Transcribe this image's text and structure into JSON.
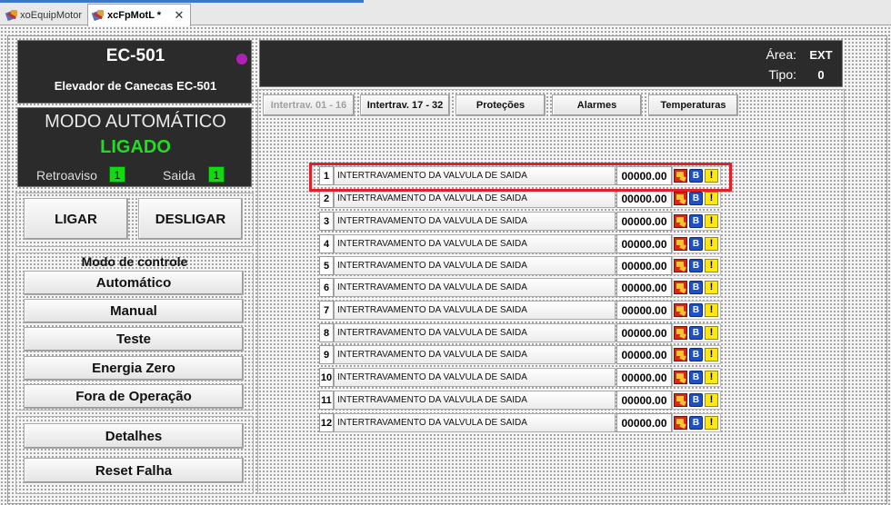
{
  "tabs": [
    {
      "label": "xoEquipMotor",
      "active": false
    },
    {
      "label": "xcFpMotL *",
      "active": true
    }
  ],
  "tab_close_glyph": "✕",
  "equipment": {
    "tag": "EC-501",
    "description": "Elevador de Canecas EC-501",
    "status_dot_color": "#b21fb8"
  },
  "mode_panel": {
    "title": "MODO AUTOMÁTICO",
    "state": "LIGADO",
    "retroaviso_label": "Retroaviso",
    "retroaviso_value": "1",
    "saida_label": "Saida",
    "saida_value": "1"
  },
  "commands": {
    "ligar": "LIGAR",
    "desligar": "DESLIGAR"
  },
  "control_mode": {
    "title": "Modo de controle",
    "options": [
      "Automático",
      "Manual",
      "Teste",
      "Energia Zero",
      "Fora de Operação"
    ]
  },
  "actions": {
    "detalhes": "Detalhes",
    "reset": "Reset Falha"
  },
  "info": {
    "area_label": "Área:",
    "area_value": "EXT",
    "tipo_label": "Tipo:",
    "tipo_value": "0"
  },
  "page_tabs": [
    {
      "label": "Intertrav. 01 - 16",
      "enabled": false
    },
    {
      "label": "Intertrav. 17 - 32",
      "enabled": true
    },
    {
      "label": "Proteções",
      "enabled": true
    },
    {
      "label": "Alarmes",
      "enabled": true
    },
    {
      "label": "Temperaturas",
      "enabled": true
    }
  ],
  "interlocks": [
    {
      "num": "1",
      "text": "INTERTRAVAMENTO DA VALVULA DE SAIDA",
      "value": "00000.00"
    },
    {
      "num": "2",
      "text": "INTERTRAVAMENTO DA VALVULA DE SAIDA",
      "value": "00000.00"
    },
    {
      "num": "3",
      "text": "INTERTRAVAMENTO DA VALVULA DE SAIDA",
      "value": "00000.00"
    },
    {
      "num": "4",
      "text": "INTERTRAVAMENTO DA VALVULA DE SAIDA",
      "value": "00000.00"
    },
    {
      "num": "5",
      "text": "INTERTRAVAMENTO DA VALVULA DE SAIDA",
      "value": "00000.00"
    },
    {
      "num": "6",
      "text": "INTERTRAVAMENTO DA VALVULA DE SAIDA",
      "value": "00000.00"
    },
    {
      "num": "7",
      "text": "INTERTRAVAMENTO DA VALVULA DE SAIDA",
      "value": "00000.00"
    },
    {
      "num": "8",
      "text": "INTERTRAVAMENTO DA VALVULA DE SAIDA",
      "value": "00000.00"
    },
    {
      "num": "9",
      "text": "INTERTRAVAMENTO DA VALVULA DE SAIDA",
      "value": "00000.00"
    },
    {
      "num": "10",
      "text": "INTERTRAVAMENTO DA VALVULA DE SAIDA",
      "value": "00000.00"
    },
    {
      "num": "11",
      "text": "INTERTRAVAMENTO DA VALVULA DE SAIDA",
      "value": "00000.00"
    },
    {
      "num": "12",
      "text": "INTERTRAVAMENTO DA VALVULA DE SAIDA",
      "value": "00000.00"
    }
  ],
  "row_icons": {
    "bypass_letter": "B",
    "alarm_glyph": "!"
  },
  "highlight_color": "#e0202a",
  "highlighted_row": "1"
}
